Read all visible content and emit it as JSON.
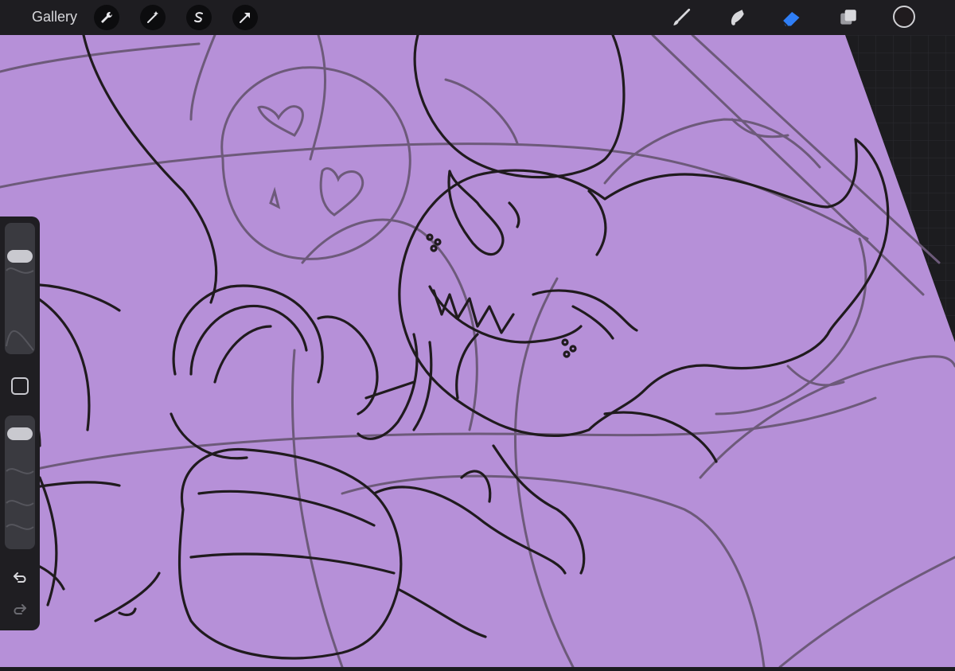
{
  "app": {
    "gallery_label": "Gallery"
  },
  "toolbar": {
    "left_buttons": [
      "wrench-icon",
      "magic-wand-icon",
      "selection-s-icon",
      "transform-arrow-icon"
    ],
    "right_tools": [
      "brush-icon",
      "smudge-icon",
      "eraser-icon",
      "layers-icon"
    ],
    "active_tool": "eraser",
    "current_color": "#201b1e"
  },
  "sidebar": {
    "brush_size_level": 0.22,
    "opacity_level": 0.08,
    "modify_button": "square-icon",
    "undo": "undo-icon",
    "redo": "redo-icon"
  },
  "canvas": {
    "fill_color": "#b690d8",
    "line_color": "#201b1e",
    "sketch_color": "#6d5a7a"
  },
  "colors": {
    "toolbar_bg": "#1e1d21",
    "accent_active": "#2f7ef6",
    "background_grid": "#1c1c1f"
  }
}
